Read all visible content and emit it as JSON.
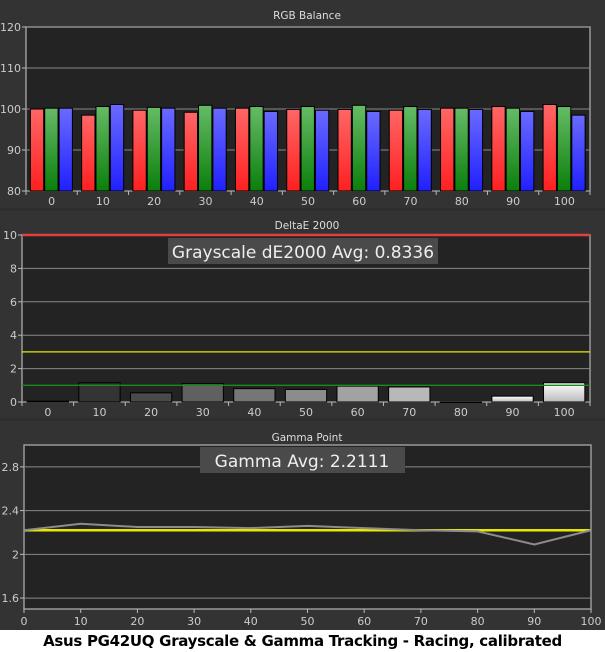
{
  "caption": "Asus PG42UQ Grayscale & Gamma Tracking - Racing, calibrated",
  "colors": {
    "red": "#ff2020",
    "green": "#1a9a1a",
    "blue": "#2020ff",
    "refRed": "#e04040",
    "refYellow": "#e8e800",
    "refGreen": "#1a8a1a",
    "plotBg": "#232323",
    "panelBg": "#333333"
  },
  "chart_data": [
    {
      "type": "bar",
      "title": "RGB Balance",
      "categories": [
        "0",
        "10",
        "20",
        "30",
        "40",
        "50",
        "60",
        "70",
        "80",
        "90",
        "100"
      ],
      "yticks": [
        "80",
        "90",
        "100",
        "110",
        "120"
      ],
      "ylim": [
        80,
        120
      ],
      "grid": true,
      "series": [
        {
          "name": "Red",
          "values": [
            100.0,
            98.5,
            99.7,
            99.2,
            100.2,
            99.9,
            99.9,
            99.7,
            100.2,
            100.6,
            101.1
          ]
        },
        {
          "name": "Green",
          "values": [
            100.2,
            100.6,
            100.4,
            100.9,
            100.6,
            100.6,
            100.9,
            100.6,
            100.2,
            100.2,
            100.6
          ]
        },
        {
          "name": "Blue",
          "values": [
            100.2,
            101.1,
            100.2,
            100.2,
            99.4,
            99.7,
            99.4,
            99.9,
            99.9,
            99.4,
            98.5
          ]
        }
      ]
    },
    {
      "type": "bar",
      "title": "DeltaE 2000",
      "annotation": "Grayscale dE2000 Avg: 0.8336",
      "categories": [
        "0",
        "10",
        "20",
        "30",
        "40",
        "50",
        "60",
        "70",
        "80",
        "90",
        "100"
      ],
      "yticks": [
        "0",
        "2",
        "4",
        "6",
        "8",
        "10"
      ],
      "ylim": [
        0,
        10
      ],
      "grid": true,
      "values": [
        0.05,
        1.15,
        0.55,
        1.1,
        0.8,
        0.75,
        0.95,
        0.9,
        0.0,
        0.35,
        1.15
      ],
      "reference_lines": [
        10,
        3,
        1
      ]
    },
    {
      "type": "line",
      "title": "Gamma Point",
      "annotation": "Gamma Avg: 2.2111",
      "x": [
        0,
        10,
        20,
        30,
        40,
        50,
        60,
        70,
        80,
        90,
        100
      ],
      "xticks": [
        "0",
        "10",
        "20",
        "30",
        "40",
        "50",
        "60",
        "70",
        "80",
        "90",
        "100"
      ],
      "yticks": [
        "1.6",
        "2",
        "2.4",
        "2.8"
      ],
      "ytick_values": [
        1.6,
        2.0,
        2.4,
        2.8
      ],
      "ylim": [
        1.5,
        3.0
      ],
      "xlim": [
        0,
        100
      ],
      "grid": true,
      "series": [
        {
          "name": "Measured",
          "values": [
            2.22,
            2.28,
            2.25,
            2.25,
            2.24,
            2.26,
            2.24,
            2.22,
            2.21,
            2.09,
            2.22
          ]
        },
        {
          "name": "Target",
          "values": [
            2.22,
            2.22,
            2.22,
            2.22,
            2.22,
            2.22,
            2.22,
            2.22,
            2.22,
            2.22,
            2.22
          ]
        }
      ]
    }
  ]
}
